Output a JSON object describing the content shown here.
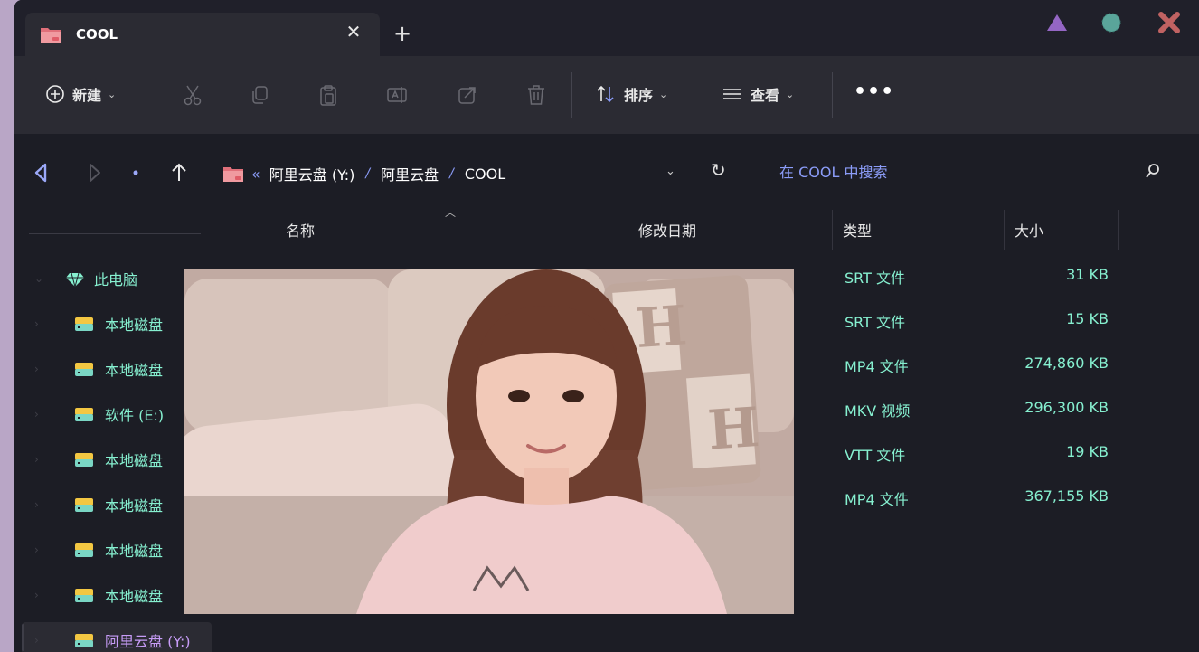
{
  "colors": {
    "accent": "#8b9cf8",
    "teal": "#86f0d0",
    "purple": "#c79cf7",
    "window_bg": "#1c1d25",
    "toolbar_bg": "#2b2b33"
  },
  "tab": {
    "title": "COOL",
    "close": "✕",
    "new": "+"
  },
  "window_controls": [
    "triangle-icon",
    "circle-icon",
    "close-x-icon"
  ],
  "toolbar": {
    "new_label": "新建",
    "sort_label": "排序",
    "view_label": "查看",
    "more": "•••",
    "icons": [
      "cut-icon",
      "copy-icon",
      "paste-icon",
      "rename-icon",
      "share-icon",
      "delete-icon"
    ]
  },
  "address": {
    "lead": "«",
    "crumbs": [
      "阿里云盘 (Y:)",
      "阿里云盘",
      "COOL"
    ],
    "separator": "/",
    "search_placeholder": "在 COOL 中搜索"
  },
  "columns": {
    "name": "名称",
    "date": "修改日期",
    "type": "类型",
    "size": "大小"
  },
  "nav_tree": [
    {
      "label": "此电脑",
      "icon": "gem-icon"
    },
    {
      "label": "本地磁盘",
      "icon": "drive-icon"
    },
    {
      "label": "本地磁盘",
      "icon": "drive-icon"
    },
    {
      "label": "软件 (E:)",
      "icon": "drive-icon"
    },
    {
      "label": "本地磁盘",
      "icon": "drive-icon"
    },
    {
      "label": "本地磁盘",
      "icon": "drive-icon"
    },
    {
      "label": "本地磁盘",
      "icon": "drive-icon"
    },
    {
      "label": "本地磁盘",
      "icon": "drive-icon"
    },
    {
      "label": "阿里云盘 (Y:)",
      "icon": "drive-icon",
      "selected": true
    }
  ],
  "files": [
    {
      "type": "SRT 文件",
      "size": "31 KB"
    },
    {
      "type": "SRT 文件",
      "size": "15 KB"
    },
    {
      "type": "MP4 文件",
      "size": "274,860 KB"
    },
    {
      "type": "MKV 视频",
      "size": "296,300 KB"
    },
    {
      "type": "VTT 文件",
      "size": "19 KB"
    },
    {
      "type": "MP4 文件",
      "size": "367,155 KB"
    }
  ],
  "preview": {
    "kind": "photo",
    "subject": "person-photo"
  }
}
